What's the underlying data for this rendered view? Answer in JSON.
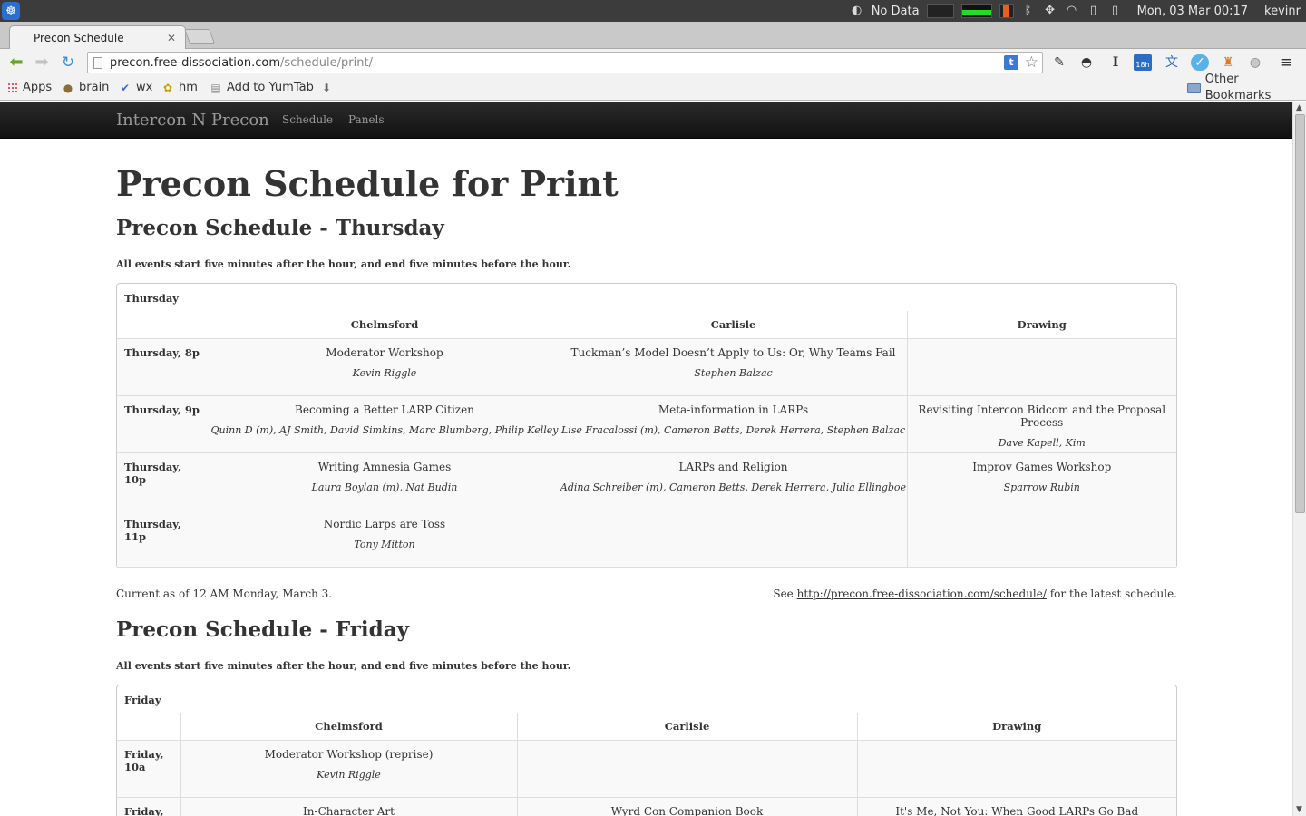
{
  "os_panel": {
    "no_data_label": "No Data",
    "datetime": "Mon, 03 Mar  00:17",
    "username": "kevinr"
  },
  "browser": {
    "tab_title": "Precon Schedule",
    "url_host": "precon.free-dissociation.com",
    "url_path": "/schedule/print/",
    "extension_badge": "18h",
    "bookmarks": [
      {
        "label": "Apps",
        "icon": "apps-grid-icon"
      },
      {
        "label": "brain",
        "icon": "brain-icon"
      },
      {
        "label": "wx",
        "icon": "wx-icon"
      },
      {
        "label": "hm",
        "icon": "hm-icon"
      },
      {
        "label": "Add to YumTab",
        "icon": "page-icon"
      }
    ],
    "other_bookmarks": "Other Bookmarks"
  },
  "site_nav": {
    "brand": "Intercon N Precon",
    "links": [
      "Schedule",
      "Panels"
    ]
  },
  "page": {
    "title": "Precon Schedule for Print",
    "current_as_of": "Current as of 12 AM Monday, March 3.",
    "see_prefix": "See ",
    "see_link": "http://precon.free-dissociation.com/schedule/",
    "see_suffix": " for the latest schedule."
  },
  "days": [
    {
      "heading": "Precon Schedule - Thursday",
      "note": "All events start five minutes after the hour, and end five minutes before the hour.",
      "caption": "Thursday",
      "rooms": [
        "Chelmsford",
        "Carlisle",
        "Drawing"
      ],
      "slots": [
        {
          "time": "Thursday, 8p",
          "events": [
            {
              "title": "Moderator Workshop",
              "people": "Kevin Riggle"
            },
            {
              "title": "Tuckman’s Model Doesn’t Apply to Us: Or, Why Teams Fail",
              "people": "Stephen Balzac"
            },
            {
              "title": "",
              "people": ""
            }
          ]
        },
        {
          "time": "Thursday, 9p",
          "events": [
            {
              "title": "Becoming a Better LARP Citizen",
              "people": "Quinn D (m), AJ Smith, David Simkins, Marc Blumberg, Philip Kelley"
            },
            {
              "title": "Meta-information in LARPs",
              "people": "Lise Fracalossi (m), Cameron Betts, Derek Herrera, Stephen Balzac"
            },
            {
              "title": "Revisiting Intercon Bidcom and the Proposal Process",
              "people": "Dave Kapell, Kim"
            }
          ]
        },
        {
          "time": "Thursday, 10p",
          "events": [
            {
              "title": "Writing Amnesia Games",
              "people": "Laura Boylan (m), Nat Budin"
            },
            {
              "title": "LARPs and Religion",
              "people": "Adina Schreiber (m), Cameron Betts, Derek Herrera, Julia Ellingboe"
            },
            {
              "title": "Improv Games Workshop",
              "people": "Sparrow Rubin"
            }
          ]
        },
        {
          "time": "Thursday, 11p",
          "events": [
            {
              "title": "Nordic Larps are Toss",
              "people": "Tony Mitton"
            },
            {
              "title": "",
              "people": ""
            },
            {
              "title": "",
              "people": ""
            }
          ]
        }
      ]
    },
    {
      "heading": "Precon Schedule - Friday",
      "note": "All events start five minutes after the hour, and end five minutes before the hour.",
      "caption": "Friday",
      "rooms": [
        "Chelmsford",
        "Carlisle",
        "Drawing"
      ],
      "slots": [
        {
          "time": "Friday, 10a",
          "events": [
            {
              "title": "Moderator Workshop (reprise)",
              "people": "Kevin Riggle"
            },
            {
              "title": "",
              "people": ""
            },
            {
              "title": "",
              "people": ""
            }
          ]
        },
        {
          "time": "Friday,",
          "events": [
            {
              "title": "In-Character Art",
              "people": ""
            },
            {
              "title": "Wyrd Con Companion Book",
              "people": ""
            },
            {
              "title": "It's Me, Not You: When Good LARPs Go Bad",
              "people": ""
            }
          ]
        }
      ]
    }
  ]
}
